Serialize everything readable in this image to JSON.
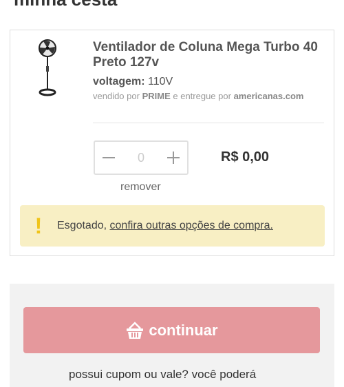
{
  "page": {
    "title": "minha cesta"
  },
  "item": {
    "name": "Ventilador de Coluna Mega Turbo 40 Preto 127v",
    "variant_label": "voltagem:",
    "variant_value": "110V",
    "seller_prefix": "vendido por",
    "seller_name": "PRIME",
    "delivery_prefix": "e entregue por",
    "delivery_name": "americanas.com",
    "quantity": "0",
    "price": "R$ 0,00",
    "remove_label": "remover",
    "image_icon": "standing-fan-icon"
  },
  "alert": {
    "icon": "!",
    "status": "Esgotado,",
    "link_text": "confira outras opções de compra."
  },
  "summary": {
    "continue_label": "continuar",
    "continue_icon": "basket-icon",
    "coupon_text": "possui cupom ou vale? você poderá"
  },
  "colors": {
    "continue_bg": "#e5989c",
    "alert_bg": "#f8efc4",
    "alert_icon": "#f0c419"
  }
}
